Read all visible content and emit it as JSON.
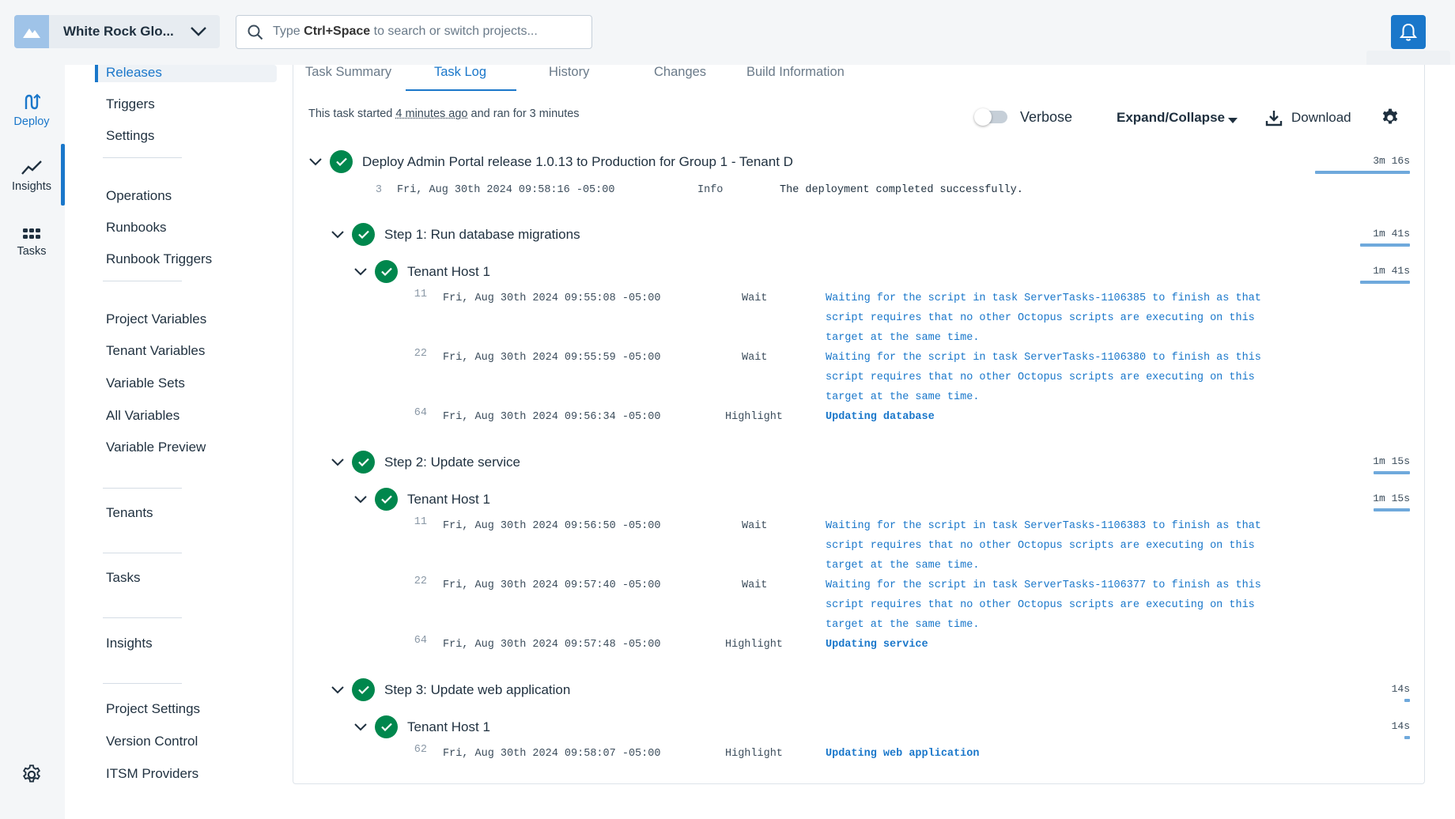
{
  "header": {
    "space_name": "White Rock Glo...",
    "search_placeholder_pre": "Type ",
    "search_placeholder_key": "Ctrl+Space",
    "search_placeholder_post": " to search or switch projects..."
  },
  "rail": {
    "deploy": "Deploy",
    "insights": "Insights",
    "tasks": "Tasks"
  },
  "sidenav": {
    "releases": "Releases",
    "triggers": "Triggers",
    "settings": "Settings",
    "operations": "Operations",
    "runbooks": "Runbooks",
    "runbook_triggers": "Runbook Triggers",
    "project_variables": "Project Variables",
    "tenant_variables": "Tenant Variables",
    "variable_sets": "Variable Sets",
    "all_variables": "All Variables",
    "variable_preview": "Variable Preview",
    "tenants": "Tenants",
    "tasks": "Tasks",
    "insights": "Insights",
    "project_settings": "Project Settings",
    "version_control": "Version Control",
    "itsm_providers": "ITSM Providers"
  },
  "tabs": {
    "task_summary": "Task Summary",
    "task_log": "Task Log",
    "history": "History",
    "changes": "Changes",
    "build_information": "Build Information"
  },
  "task": {
    "started_pre": "This task started ",
    "started_ago": "4 minutes ago",
    "started_post": " and ran for 3 minutes"
  },
  "toolbar": {
    "verbose": "Verbose",
    "expand_collapse": "Expand/Collapse",
    "download": "Download"
  },
  "log": {
    "root": {
      "title": "Deploy Admin Portal release 1.0.13 to Production for Group 1 - Tenant D",
      "duration": "3m 16s",
      "line": {
        "num": "3",
        "ts": "Fri, Aug 30th 2024 09:58:16 -05:00",
        "cat": "Info",
        "msg": "The deployment completed successfully."
      }
    },
    "step1": {
      "title": "Step 1: Run database migrations",
      "duration": "1m 41s",
      "host": "Tenant Host 1",
      "host_duration": "1m 41s",
      "lines": [
        {
          "num": "11",
          "ts": "Fri, Aug 30th 2024 09:55:08 -05:00",
          "cat": "Wait",
          "msg": "Waiting for the script in task ServerTasks-1106385 to finish as that script requires that no other Octopus scripts are executing on this target at the same time."
        },
        {
          "num": "22",
          "ts": "Fri, Aug 30th 2024 09:55:59 -05:00",
          "cat": "Wait",
          "msg": "Waiting for the script in task ServerTasks-1106380 to finish as this script requires that no other Octopus scripts are executing on this target at the same time."
        },
        {
          "num": "64",
          "ts": "Fri, Aug 30th 2024 09:56:34 -05:00",
          "cat": "Highlight",
          "msg": "Updating database"
        }
      ]
    },
    "step2": {
      "title": "Step 2: Update service",
      "duration": "1m 15s",
      "host": "Tenant Host 1",
      "host_duration": "1m 15s",
      "lines": [
        {
          "num": "11",
          "ts": "Fri, Aug 30th 2024 09:56:50 -05:00",
          "cat": "Wait",
          "msg": "Waiting for the script in task ServerTasks-1106383 to finish as that script requires that no other Octopus scripts are executing on this target at the same time."
        },
        {
          "num": "22",
          "ts": "Fri, Aug 30th 2024 09:57:40 -05:00",
          "cat": "Wait",
          "msg": "Waiting for the script in task ServerTasks-1106377 to finish as this script requires that no other Octopus scripts are executing on this target at the same time."
        },
        {
          "num": "64",
          "ts": "Fri, Aug 30th 2024 09:57:48 -05:00",
          "cat": "Highlight",
          "msg": "Updating service"
        }
      ]
    },
    "step3": {
      "title": "Step 3: Update web application",
      "duration": "14s",
      "host": "Tenant Host 1",
      "host_duration": "14s",
      "lines": [
        {
          "num": "62",
          "ts": "Fri, Aug 30th 2024 09:58:07 -05:00",
          "cat": "Highlight",
          "msg": "Updating web application"
        }
      ]
    }
  }
}
